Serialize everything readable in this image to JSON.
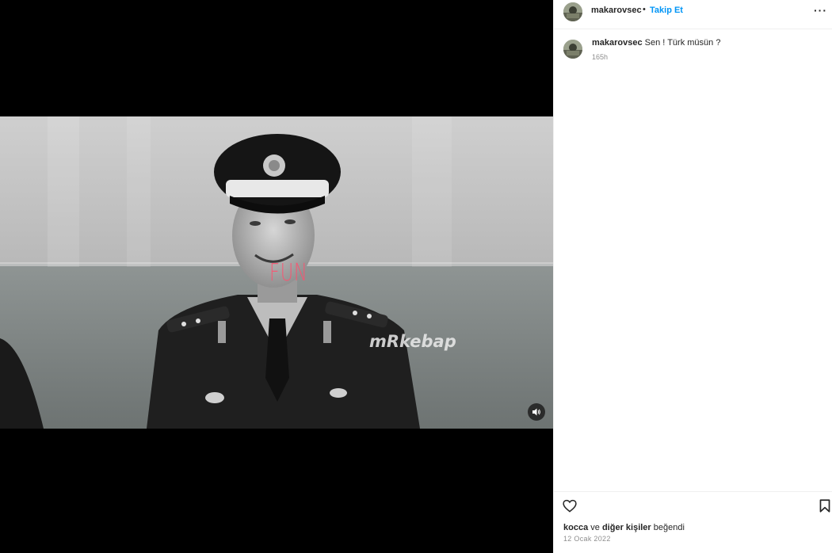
{
  "post": {
    "username": "makarovsec",
    "separator": "•",
    "follow_label": "Takip Et",
    "more_label": "···",
    "caption_username": "makarovsec",
    "caption_text": "Sen ! Türk müsün ?",
    "caption_time": "165h",
    "liked_by_user": "kocca",
    "liked_by_connector": "ve",
    "liked_by_others": "diğer kişiler",
    "liked_by_suffix": "beğendi",
    "date": "12 Ocak 2022"
  },
  "video": {
    "overlay_text": "FUN",
    "watermark": "mRkebap"
  },
  "icons": {
    "avatar": "avatar-icon",
    "more": "more-options-icon",
    "mute": "speaker-icon",
    "like": "heart-icon",
    "save": "bookmark-icon"
  },
  "colors": {
    "link": "#0095f6",
    "text": "#262626",
    "muted": "#8e8e8e",
    "border": "#efefef",
    "media_bg": "#000000"
  }
}
